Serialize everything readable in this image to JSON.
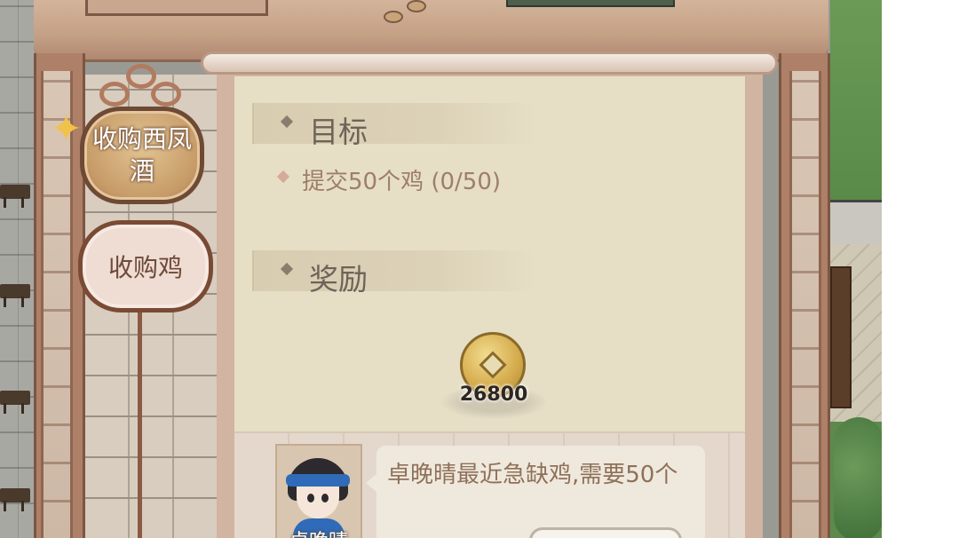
{
  "tabs": [
    {
      "label": "收购西凤酒",
      "active": true
    },
    {
      "label": "收购鸡",
      "active": false
    }
  ],
  "sections": {
    "goal_title": "目标",
    "task_text": "提交50个鸡 (0/50)",
    "reward_title": "奖励"
  },
  "reward": {
    "icon": "copper-coin-icon",
    "amount": "26800"
  },
  "dialogue": {
    "text": "卓晚晴最近急缺鸡,需要50个",
    "npc_name": "卓晚晴"
  },
  "colors": {
    "panel_bg": "#e6dfc5",
    "frame_wood": "#ad8067",
    "tab_active_fill": "#c69b67",
    "task_text": "#9e7e6a",
    "dialogue_text": "#8f7059"
  }
}
